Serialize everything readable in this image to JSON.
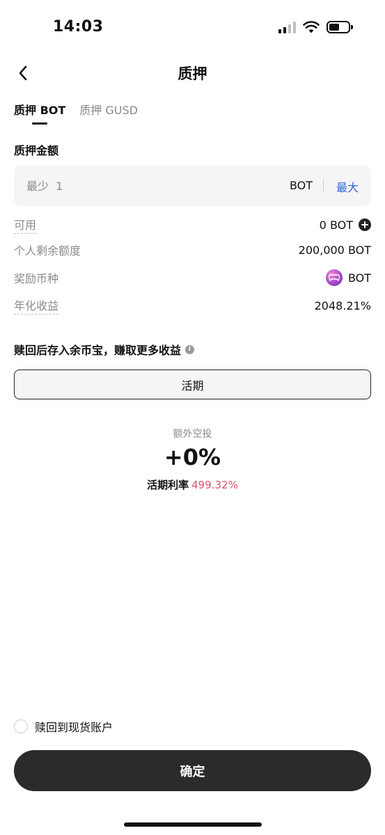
{
  "status_bar": {
    "time": "14:03",
    "signal_bars_on": 2,
    "signal_bars_total": 4,
    "battery_level": 0.55
  },
  "nav": {
    "back_icon": "chevron-left-icon",
    "title": "质押"
  },
  "tabs": [
    {
      "label": "质押 BOT",
      "active": true
    },
    {
      "label": "质押 GUSD",
      "active": false
    }
  ],
  "amount": {
    "section_label": "质押金额",
    "placeholder": "最少  1",
    "value": "",
    "unit": "BOT",
    "max_label": "最大"
  },
  "info_rows": {
    "available_label": "可用",
    "available_value": "0 BOT",
    "remaining_quota_label": "个人剩余额度",
    "remaining_quota_value": "200,000 BOT",
    "reward_coin_label": "奖励币种",
    "reward_coin_value": "BOT",
    "apr_label": "年化收益",
    "apr_value": "2048.21%"
  },
  "redeem": {
    "note": "赎回后存入余币宝，赚取更多收益",
    "option_label": "活期"
  },
  "airdrop": {
    "label": "额外空投",
    "value": "+0%",
    "rate_label": "活期利率",
    "rate_value": "499.32%"
  },
  "redeem_to_spot": {
    "label": "赎回到现货账户",
    "checked": false
  },
  "confirm_label": "确定",
  "colors": {
    "accent_blue": "#2a65d9",
    "rate_red": "#d9546c",
    "button_dark": "#2b2b2d"
  }
}
